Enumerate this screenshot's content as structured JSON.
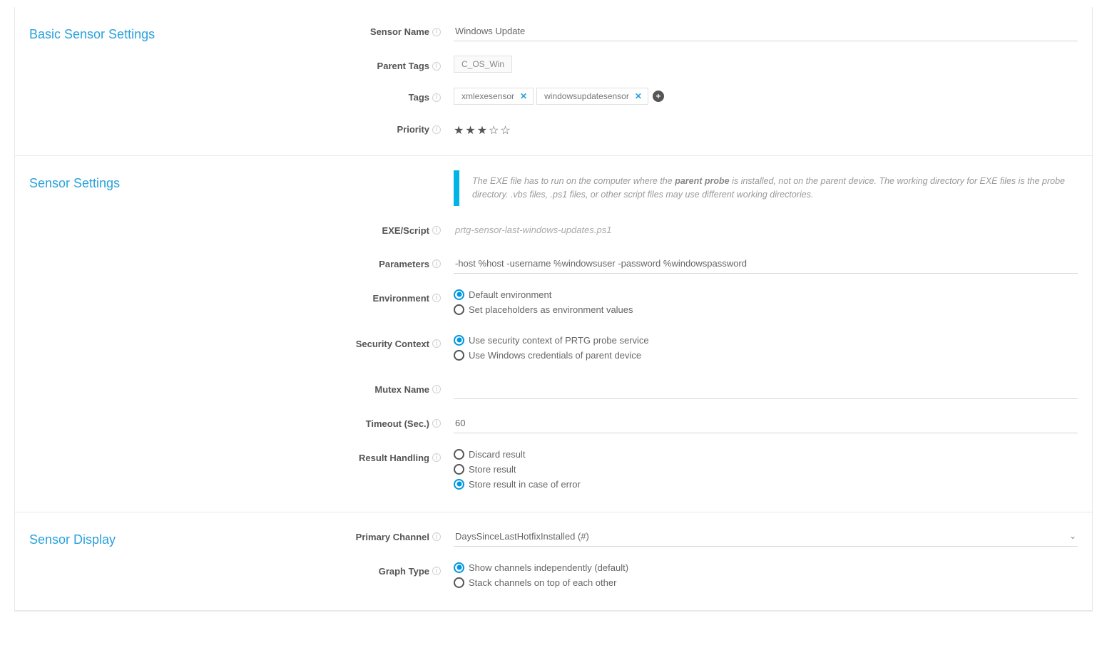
{
  "basic": {
    "title": "Basic Sensor Settings",
    "sensorNameLabel": "Sensor Name",
    "sensorNameValue": "Windows Update",
    "parentTagsLabel": "Parent Tags",
    "parentTagsValue": "C_OS_Win",
    "tagsLabel": "Tags",
    "tags": [
      "xmlexesensor",
      "windowsupdatesensor"
    ],
    "priorityLabel": "Priority",
    "priorityValue": 3,
    "priorityMax": 5
  },
  "sensor": {
    "title": "Sensor Settings",
    "infoTextPre": "The EXE file has to run on the computer where the ",
    "infoBold": "parent probe",
    "infoTextPost": " is installed, not on the parent device. The working directory for EXE files is the probe directory. .vbs files, .ps1 files, or other script files may use different working directories.",
    "exeLabel": "EXE/Script",
    "exeValue": "prtg-sensor-last-windows-updates.ps1",
    "paramsLabel": "Parameters",
    "paramsValue": "-host %host -username %windowsuser -password %windowspassword",
    "envLabel": "Environment",
    "envOptions": [
      "Default environment",
      "Set placeholders as environment values"
    ],
    "envSelected": 0,
    "secLabel": "Security Context",
    "secOptions": [
      "Use security context of PRTG probe service",
      "Use Windows credentials of parent device"
    ],
    "secSelected": 0,
    "mutexLabel": "Mutex Name",
    "mutexValue": "",
    "timeoutLabel": "Timeout (Sec.)",
    "timeoutValue": "60",
    "resultLabel": "Result Handling",
    "resultOptions": [
      "Discard result",
      "Store result",
      "Store result in case of error"
    ],
    "resultSelected": 2
  },
  "display": {
    "title": "Sensor Display",
    "primaryLabel": "Primary Channel",
    "primaryValue": "DaysSinceLastHotfixInstalled (#)",
    "graphLabel": "Graph Type",
    "graphOptions": [
      "Show channels independently (default)",
      "Stack channels on top of each other"
    ],
    "graphSelected": 0
  }
}
